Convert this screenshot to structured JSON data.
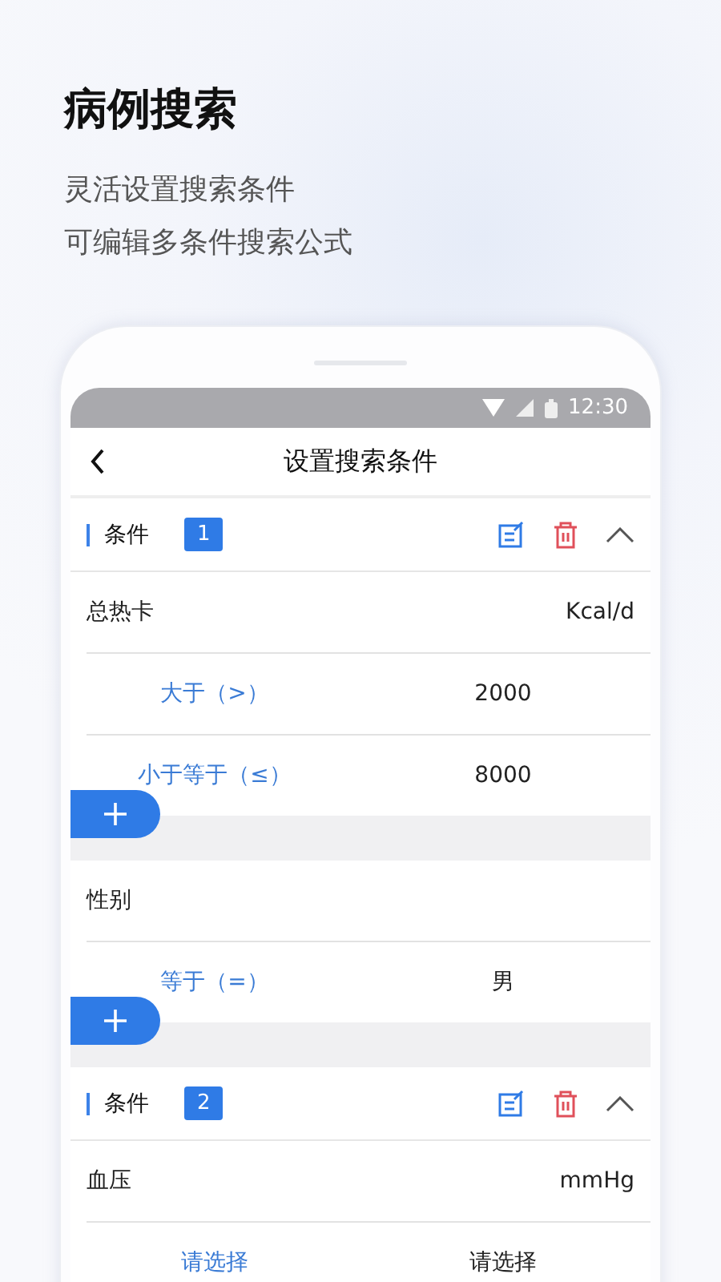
{
  "hero": {
    "title": "病例搜索",
    "lines": [
      "灵活设置搜索条件",
      "可编辑多条件搜索公式"
    ]
  },
  "status_bar": {
    "time": "12:30"
  },
  "nav": {
    "title": "设置搜索条件"
  },
  "conditions": [
    {
      "label": "条件",
      "number": "1",
      "expanded": true,
      "fields": [
        {
          "name": "总热卡",
          "unit": "Kcal/d",
          "add_button": true,
          "rules": [
            {
              "operator": "大于（>）",
              "value": "2000"
            },
            {
              "operator": "小于等于（≤）",
              "value": "8000"
            }
          ]
        },
        {
          "name": "性别",
          "add_button": true,
          "rules": [
            {
              "operator": "等于（=）",
              "value": "男"
            }
          ]
        }
      ]
    },
    {
      "label": "条件",
      "number": "2",
      "expanded": true,
      "fields": [
        {
          "name": "血压",
          "unit": "mmHg",
          "add_button": false,
          "rules": [
            {
              "operator": "请选择",
              "value": "请选择"
            }
          ]
        }
      ]
    }
  ]
}
